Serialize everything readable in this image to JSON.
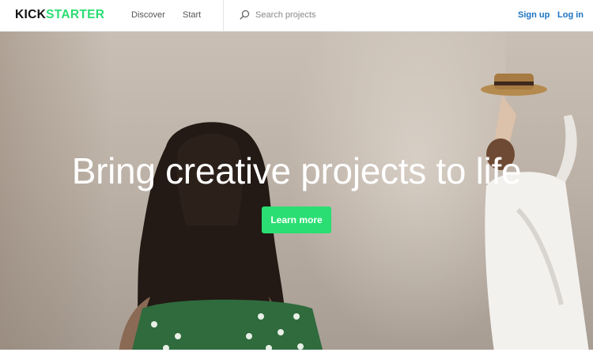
{
  "header": {
    "logo_part1": "KICK",
    "logo_part2": "STARTER",
    "nav": {
      "discover": "Discover",
      "start": "Start"
    },
    "search": {
      "placeholder": "Search projects",
      "value": "",
      "icon": "magnifier-icon"
    },
    "auth": {
      "sign_up": "Sign up",
      "log_in": "Log in"
    }
  },
  "hero": {
    "title": "Bring creative projects to life",
    "cta_label": "Learn more"
  },
  "colors": {
    "brand_green": "#2bde73",
    "link_blue": "#1a73c0",
    "logo_dark": "#111111"
  }
}
